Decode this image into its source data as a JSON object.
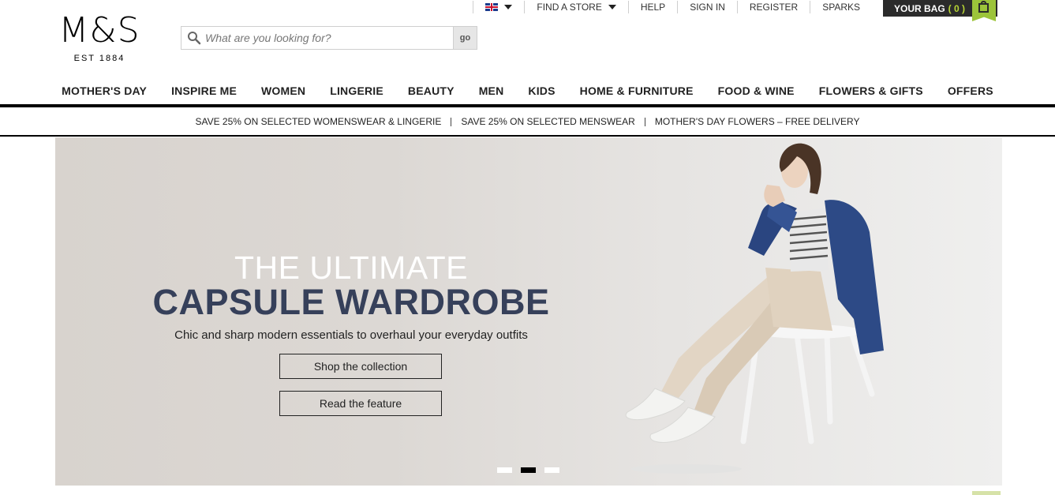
{
  "logo": {
    "mark": "M&S",
    "est": "EST 1884"
  },
  "search": {
    "placeholder": "What are you looking for?",
    "go_label": "go"
  },
  "utility": {
    "find_store": "FIND A STORE",
    "help": "HELP",
    "sign_in": "SIGN IN",
    "register": "REGISTER",
    "sparks": "SPARKS"
  },
  "bag": {
    "label": "YOUR BAG",
    "count": "( 0 )"
  },
  "nav": [
    "MOTHER'S DAY",
    "INSPIRE ME",
    "WOMEN",
    "LINGERIE",
    "BEAUTY",
    "MEN",
    "KIDS",
    "HOME & FURNITURE",
    "FOOD & WINE",
    "FLOWERS & GIFTS",
    "OFFERS"
  ],
  "promo": [
    "SAVE 25% ON SELECTED WOMENSWEAR & LINGERIE",
    "SAVE 25% ON SELECTED MENSWEAR",
    "MOTHER'S DAY FLOWERS – FREE DELIVERY"
  ],
  "hero": {
    "title_line1": "THE ULTIMATE",
    "title_line2": "CAPSULE WARDROBE",
    "subtitle": "Chic and sharp modern essentials to overhaul your everyday outfits",
    "button1": "Shop the collection",
    "button2": "Read the feature",
    "carousel": {
      "slides": 3,
      "active": 2
    }
  },
  "colors": {
    "headline_dark": "#36405a",
    "bag_bg": "#2b2b2b",
    "bag_accent": "#9cc43a"
  }
}
